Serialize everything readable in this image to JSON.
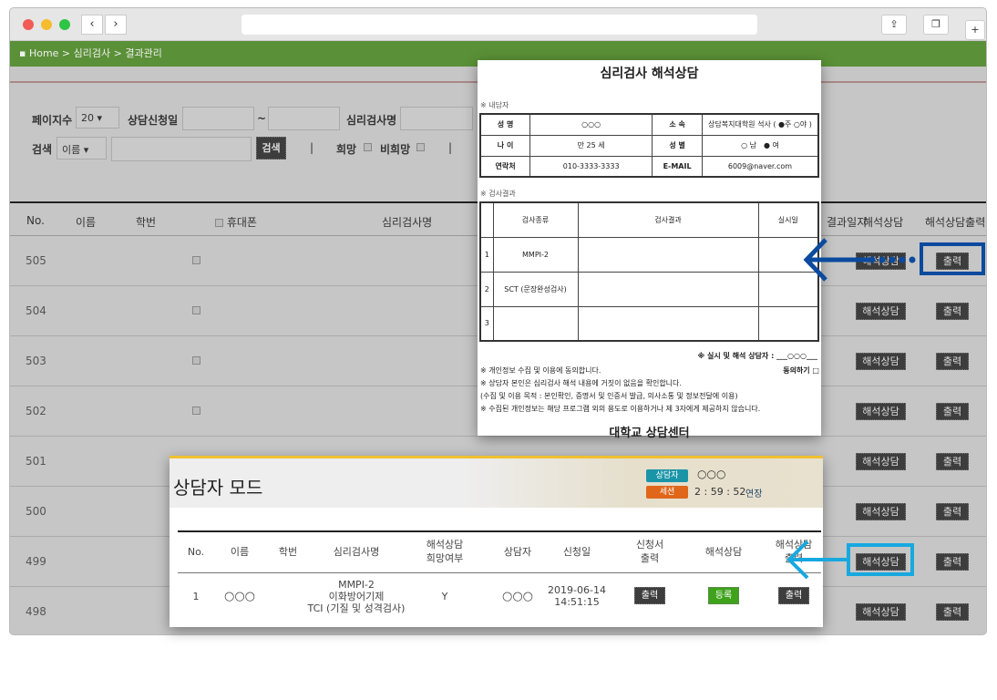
{
  "breadcrumb": "Home > 심리검사 > 결과관리",
  "filter": {
    "page_count_label": "페이지수",
    "page_count_value": "20",
    "date_label": "상담신청일",
    "date_sep": "~",
    "test_name_label": "심리검사명",
    "search_label": "검색",
    "search_field_value": "이름",
    "search_button": "검색",
    "hope_label": "희망",
    "no_hope_label": "비희망"
  },
  "table": {
    "headers": [
      "No.",
      "이름",
      "학번",
      "휴대폰",
      "심리검사명",
      "결과일지",
      "해석상담",
      "해석상담출력"
    ],
    "rows": [
      "505",
      "504",
      "503",
      "502",
      "501",
      "500",
      "499",
      "498"
    ],
    "consult_button": "해석상담",
    "print_button": "출력"
  },
  "document": {
    "title": "심리검사 해석상담",
    "client_section": "※ 내담자",
    "client": [
      [
        "성 명",
        "○○○",
        "소 속",
        "상담복지대학원 석사 ( ●주 ○야 )"
      ],
      [
        "나 이",
        "만 25 세",
        "성 별",
        "○ 남　● 여"
      ],
      [
        "연락처",
        "010-3333-3333",
        "E-MAIL",
        "6009@naver.com"
      ]
    ],
    "result_section": "※ 검사결과",
    "result_headers": [
      "",
      "검사종류",
      "검사결과",
      "실시일"
    ],
    "results": [
      [
        "1",
        "MMPI-2"
      ],
      [
        "2",
        "SCT (문장완성검사)"
      ],
      [
        "3",
        ""
      ]
    ],
    "counselor": "※ 실시 및 해석 상담자 : ___○○○___",
    "agree": "동의하기 □",
    "notes": [
      "※ 개인정보 수집 및 이용에 동의합니다.",
      "※ 상담자 본인은 심리검사 해석 내용에 거짓이 없음을 확인합니다.",
      "(수집 및 이용 목적 : 본인확인, 증명서 및 인증서 발급, 의사소통 및 정보전달에 이용)",
      "※ 수집된 개인정보는 해당 프로그램 외의 용도로 이용하거나 제 3자에게 제공하지 않습니다."
    ],
    "footer": "대학교 상담센터"
  },
  "mode": {
    "title": "상담자 모드",
    "counselor_tag": "상담자",
    "counselor_name": "○○○",
    "session_tag": "세션",
    "timer": "2 : 59 : 52",
    "extend": "연장",
    "headers": [
      "No.",
      "이름",
      "학번",
      "심리검사명",
      "해석상담\n희망여부",
      "상담자",
      "신청일",
      "신청서\n출력",
      "해석상담",
      "해석상담\n출력"
    ],
    "row": {
      "no": "1",
      "name": "○○○",
      "test": "MMPI-2\n이화방어기제\nTCI (기질 및 성격검사)",
      "hope": "Y",
      "counselor": "○○○",
      "date": "2019-06-14\n14:51:15",
      "print1": "출력",
      "register": "등록",
      "print2": "출력"
    }
  },
  "colors": {
    "green_bar": "#5a9037",
    "arrow_dark": "#0b4a9e",
    "arrow_light": "#18a8e0",
    "register": "#3ea21a",
    "session": "#e0661a",
    "counselor": "#1a95a8"
  }
}
